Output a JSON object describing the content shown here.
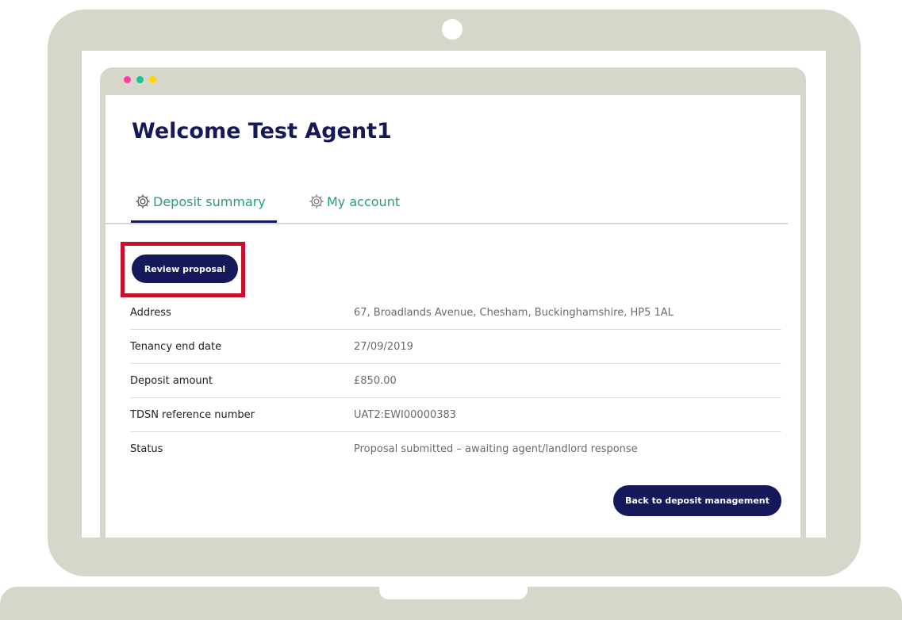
{
  "welcome_title": "Welcome Test Agent1",
  "tabs": [
    {
      "label": "Deposit summary",
      "icon": "gear-icon",
      "active": true
    },
    {
      "label": "My account",
      "icon": "gear-icon",
      "active": false
    }
  ],
  "review_button_label": "Review proposal",
  "details": [
    {
      "label": "Address",
      "value": "67, Broadlands Avenue, Chesham, Buckinghamshire, HP5 1AL"
    },
    {
      "label": "Tenancy end date",
      "value": "27/09/2019"
    },
    {
      "label": "Deposit amount",
      "value": "£850.00"
    },
    {
      "label": "TDSN reference number",
      "value": "UAT2:EWI00000383"
    },
    {
      "label": "Status",
      "value": "Proposal submitted – awaiting agent/landlord response"
    }
  ],
  "back_button_label": "Back to deposit management",
  "colors": {
    "laptop": "#d6d6ca",
    "primary": "#15195a",
    "tab_text": "#1fa46b",
    "highlight_border": "#c8102e",
    "window_dots": [
      "#ff3ea5",
      "#1fbf8f",
      "#ffd400"
    ]
  }
}
